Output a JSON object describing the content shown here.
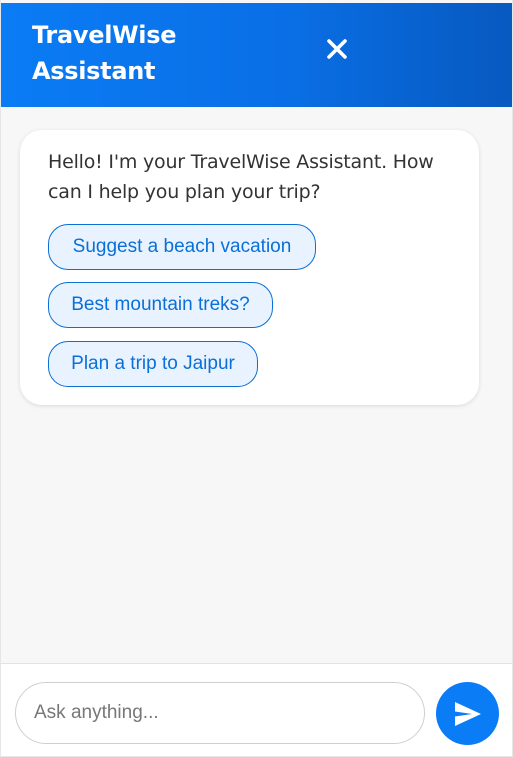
{
  "header": {
    "title": "TravelWise Assistant",
    "close_icon": "close-icon",
    "background_start": "#0a7cf5",
    "background_end": "#0759bf"
  },
  "conversation": {
    "assistant_message": "Hello! I'm your TravelWise Assistant. How can I help you plan your trip?",
    "suggestions": [
      {
        "label": "Suggest a beach vacation"
      },
      {
        "label": "Best mountain treks?"
      },
      {
        "label": "Plan a trip to Jaipur"
      }
    ]
  },
  "composer": {
    "placeholder": "Ask anything...",
    "value": "",
    "send_icon": "send-icon"
  },
  "colors": {
    "accent": "#0a7cf5",
    "chip_border": "#0a6fd6",
    "chip_background": "#e9f3ff",
    "chat_background": "#f7f7f7"
  }
}
